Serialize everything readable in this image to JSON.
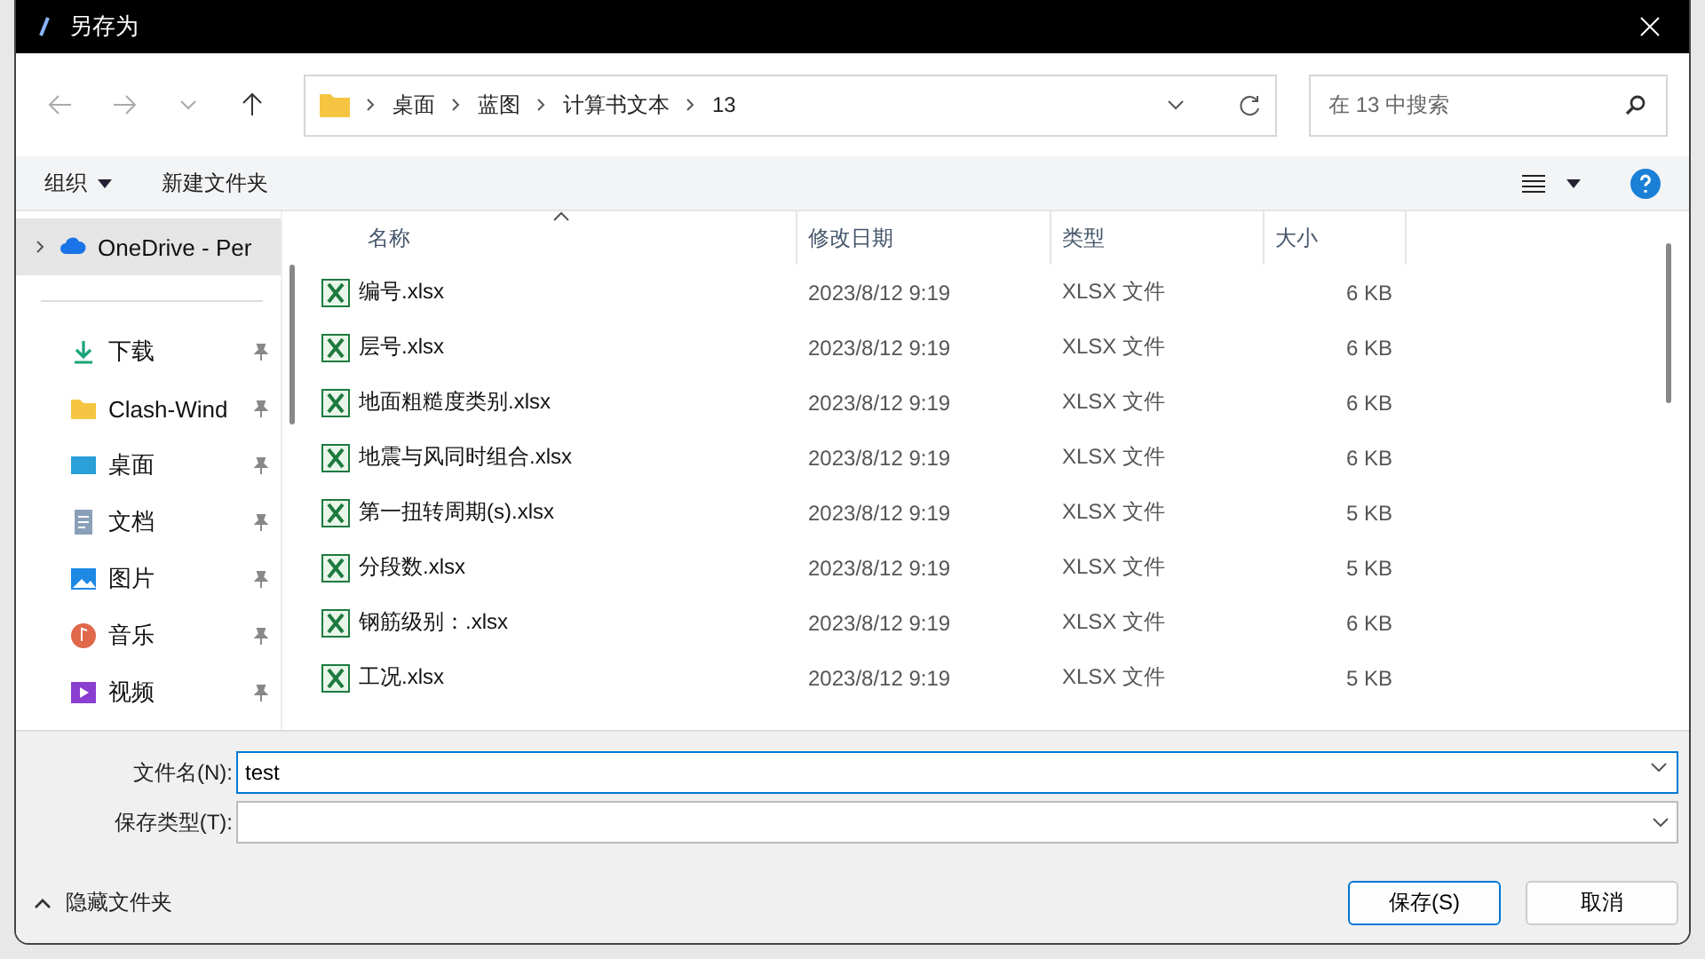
{
  "window": {
    "title": "另存为"
  },
  "address": {
    "crumbs": [
      "桌面",
      "蓝图",
      "计算书文本",
      "13"
    ]
  },
  "search": {
    "placeholder": "在 13 中搜索"
  },
  "toolbar": {
    "organize": "组织",
    "new_folder": "新建文件夹"
  },
  "sidebar": {
    "items": [
      {
        "label": "OneDrive - Per",
        "kind": "cloud",
        "pinned": false,
        "selected": true
      },
      {
        "label": "下载",
        "kind": "download",
        "pinned": true,
        "selected": false
      },
      {
        "label": "Clash-Wind",
        "kind": "folder",
        "pinned": true,
        "selected": false
      },
      {
        "label": "桌面",
        "kind": "desktop",
        "pinned": true,
        "selected": false
      },
      {
        "label": "文档",
        "kind": "document",
        "pinned": true,
        "selected": false
      },
      {
        "label": "图片",
        "kind": "picture",
        "pinned": true,
        "selected": false
      },
      {
        "label": "音乐",
        "kind": "music",
        "pinned": true,
        "selected": false
      },
      {
        "label": "视频",
        "kind": "video",
        "pinned": true,
        "selected": false
      }
    ]
  },
  "table": {
    "columns": [
      {
        "label": "名称",
        "sorted": true
      },
      {
        "label": "修改日期",
        "sorted": false
      },
      {
        "label": "类型",
        "sorted": false
      },
      {
        "label": "大小",
        "sorted": false
      }
    ],
    "rows": [
      [
        "编号.xlsx",
        "2023/8/12 9:19",
        "XLSX 文件",
        "6 KB"
      ],
      [
        "层号.xlsx",
        "2023/8/12 9:19",
        "XLSX 文件",
        "6 KB"
      ],
      [
        "地面粗糙度类别.xlsx",
        "2023/8/12 9:19",
        "XLSX 文件",
        "6 KB"
      ],
      [
        "地震与风同时组合.xlsx",
        "2023/8/12 9:19",
        "XLSX 文件",
        "6 KB"
      ],
      [
        "第一扭转周期(s).xlsx",
        "2023/8/12 9:19",
        "XLSX 文件",
        "5 KB"
      ],
      [
        "分段数.xlsx",
        "2023/8/12 9:19",
        "XLSX 文件",
        "5 KB"
      ],
      [
        "钢筋级别：.xlsx",
        "2023/8/12 9:19",
        "XLSX 文件",
        "6 KB"
      ],
      [
        "工况.xlsx",
        "2023/8/12 9:19",
        "XLSX 文件",
        "5 KB"
      ]
    ]
  },
  "filename": {
    "label": "文件名(N):",
    "value": "test"
  },
  "filetype": {
    "label": "保存类型(T):"
  },
  "footer": {
    "toggle": "隐藏文件夹",
    "expanded": true,
    "buttons": [
      "保存(S)",
      "取消"
    ]
  }
}
